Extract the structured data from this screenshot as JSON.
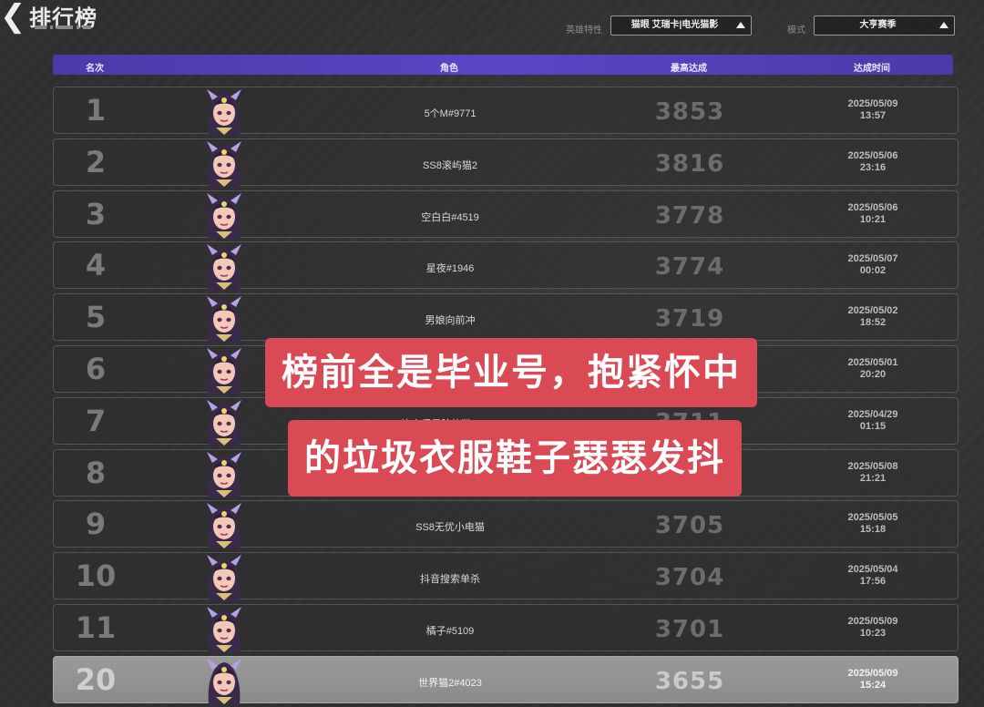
{
  "header": {
    "back_icon": "chevron-left-icon",
    "title": "排行榜"
  },
  "filters": {
    "hero_trait_label": "英雄特性",
    "hero_trait_value": "猫眼 艾瑞卡|电光猫影",
    "mode_label": "模式",
    "mode_value": "大亨赛季"
  },
  "columns": {
    "rank": "名次",
    "role": "角色",
    "best": "最高达成",
    "time": "达成时间"
  },
  "rows": [
    {
      "rank": "1",
      "name": "5个M#9771",
      "score": "3853",
      "date": "2025/05/09",
      "clock": "13:57"
    },
    {
      "rank": "2",
      "name": "SS8滚屿猫2",
      "score": "3816",
      "date": "2025/05/06",
      "clock": "23:16"
    },
    {
      "rank": "3",
      "name": "空白白#4519",
      "score": "3778",
      "date": "2025/05/06",
      "clock": "10:21"
    },
    {
      "rank": "4",
      "name": "星夜#1946",
      "score": "3774",
      "date": "2025/05/07",
      "clock": "00:02"
    },
    {
      "rank": "5",
      "name": "男娘向前冲",
      "score": "3719",
      "date": "2025/05/02",
      "clock": "18:52"
    },
    {
      "rank": "6",
      "name": "",
      "score": "",
      "date": "2025/05/01",
      "clock": "20:20"
    },
    {
      "rank": "7",
      "name": "比赤保是险的猫#1413",
      "score": "3711",
      "date": "2025/04/29",
      "clock": "01:15"
    },
    {
      "rank": "8",
      "name": "",
      "score": "",
      "date": "2025/05/08",
      "clock": "21:21"
    },
    {
      "rank": "9",
      "name": "SS8无优小电猫",
      "score": "3705",
      "date": "2025/05/05",
      "clock": "15:18"
    },
    {
      "rank": "10",
      "name": "抖音搜索单杀",
      "score": "3704",
      "date": "2025/05/04",
      "clock": "17:56"
    },
    {
      "rank": "11",
      "name": "橘子#5109",
      "score": "3701",
      "date": "2025/05/09",
      "clock": "10:23"
    },
    {
      "rank": "20",
      "name": "世界猫2#4023",
      "score": "3655",
      "date": "2025/05/09",
      "clock": "15:24"
    }
  ],
  "overlay": {
    "line1": "榜前全是毕业号，抱紧怀中",
    "line2": "的垃圾衣服鞋子瑟瑟发抖"
  },
  "colors": {
    "header_bar": "#5b45c4",
    "overlay_bg": "#d94a55",
    "highlight_row": "#8f8f8f"
  }
}
